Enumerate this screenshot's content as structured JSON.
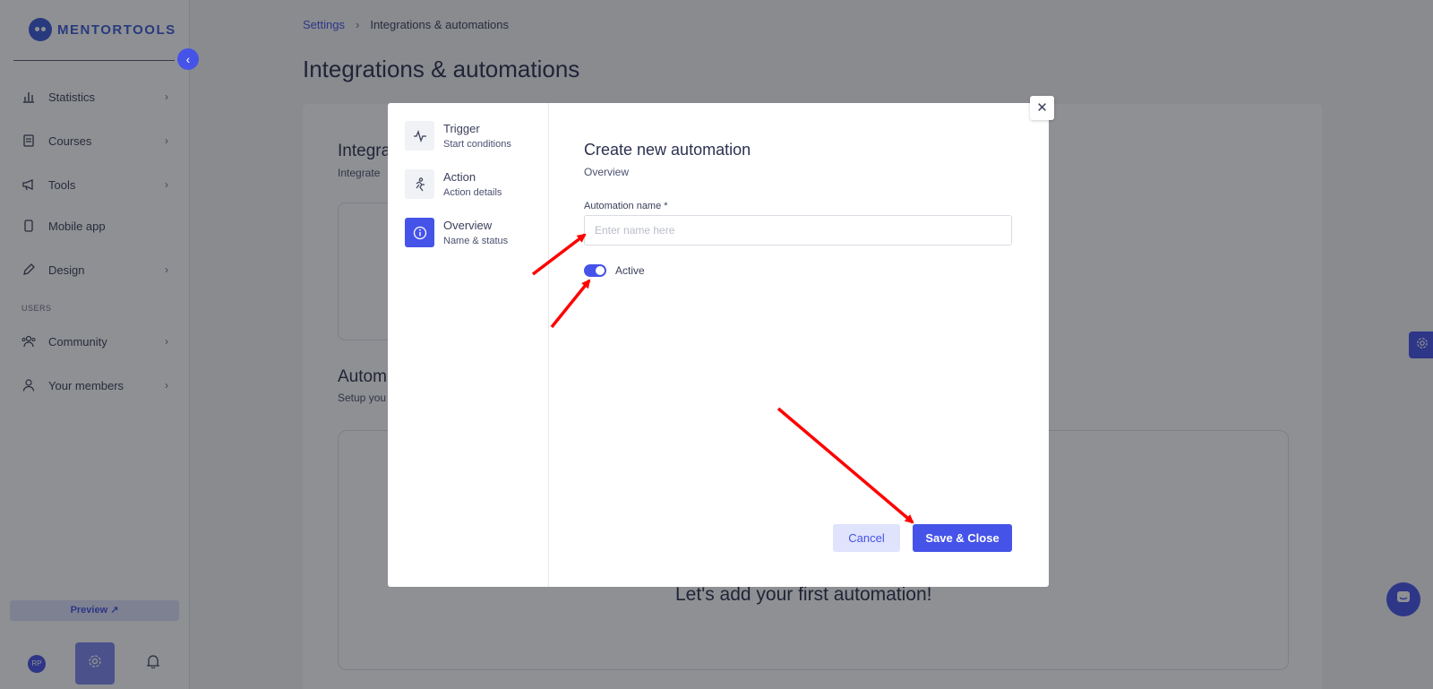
{
  "app": {
    "logo_text": "MENTORTOOLS"
  },
  "sidebar": {
    "items": [
      {
        "label": "Statistics",
        "icon": "bar-chart-icon"
      },
      {
        "label": "Courses",
        "icon": "book-icon"
      },
      {
        "label": "Tools",
        "icon": "megaphone-icon"
      },
      {
        "label": "Mobile app",
        "icon": "phone-icon"
      },
      {
        "label": "Design",
        "icon": "pencil-icon"
      }
    ],
    "users_section_label": "USERS",
    "user_items": [
      {
        "label": "Community",
        "icon": "people-icon"
      },
      {
        "label": "Your members",
        "icon": "person-icon"
      }
    ],
    "preview_label": "Preview ↗",
    "avatar_initials": "RP"
  },
  "breadcrumb": {
    "parent": "Settings",
    "current": "Integrations & automations"
  },
  "page": {
    "title": "Integrations & automations",
    "integrations_title": "Integra",
    "integrations_sub": "Integrate",
    "automations_title": "Autom",
    "automations_sub": "Setup you",
    "empty_text": "Let's add your first automation!"
  },
  "modal": {
    "steps": [
      {
        "title": "Trigger",
        "subtitle": "Start conditions",
        "icon": "pulse-icon"
      },
      {
        "title": "Action",
        "subtitle": "Action details",
        "icon": "runner-icon"
      },
      {
        "title": "Overview",
        "subtitle": "Name & status",
        "icon": "info-icon"
      }
    ],
    "title": "Create new automation",
    "subtitle": "Overview",
    "name_label": "Automation name *",
    "name_placeholder": "Enter name here",
    "name_value": "",
    "active_label": "Active",
    "active": true,
    "cancel_label": "Cancel",
    "save_label": "Save & Close",
    "close_icon": "close-icon"
  },
  "colors": {
    "accent": "#4553e8",
    "annotation": "#ff0000"
  }
}
